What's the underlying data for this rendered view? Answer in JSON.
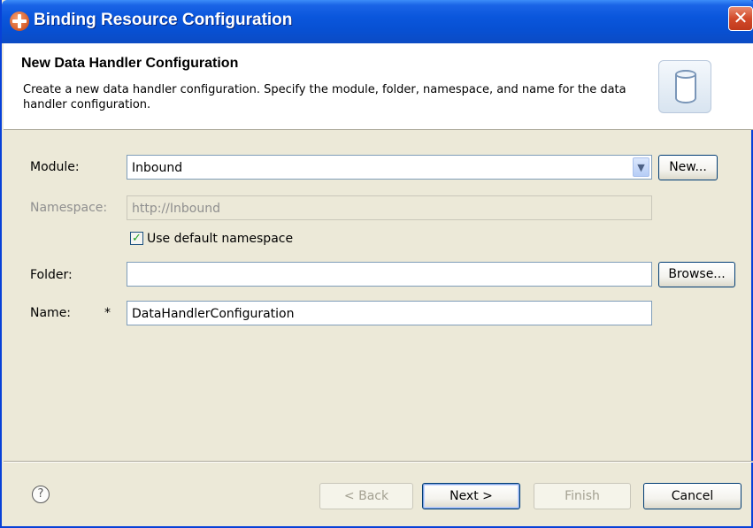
{
  "window": {
    "title": "Binding Resource Configuration",
    "close_glyph": "✕"
  },
  "banner": {
    "title": "New Data Handler Configuration",
    "description": "Create a new data handler configuration.  Specify the module, folder, namespace, and name for the data handler configuration.",
    "icon": "data-store-icon"
  },
  "form": {
    "module": {
      "label": "Module:",
      "value": "Inbound",
      "new_button": "New..."
    },
    "namespace": {
      "label": "Namespace:",
      "value": "http://Inbound",
      "disabled": true
    },
    "use_default_namespace": {
      "label": "Use default namespace",
      "checked": true
    },
    "folder": {
      "label": "Folder:",
      "value": "",
      "browse_button": "Browse..."
    },
    "name": {
      "label": "Name:",
      "required_marker": "*",
      "value": "DataHandlerConfiguration"
    }
  },
  "footer": {
    "help_glyph": "?",
    "back": "< Back",
    "next": "Next >",
    "finish": "Finish",
    "cancel": "Cancel"
  },
  "colors": {
    "titlebar": "#0a56dc",
    "dialog_bg": "#ece9d8",
    "close_button": "#d24a2a"
  }
}
